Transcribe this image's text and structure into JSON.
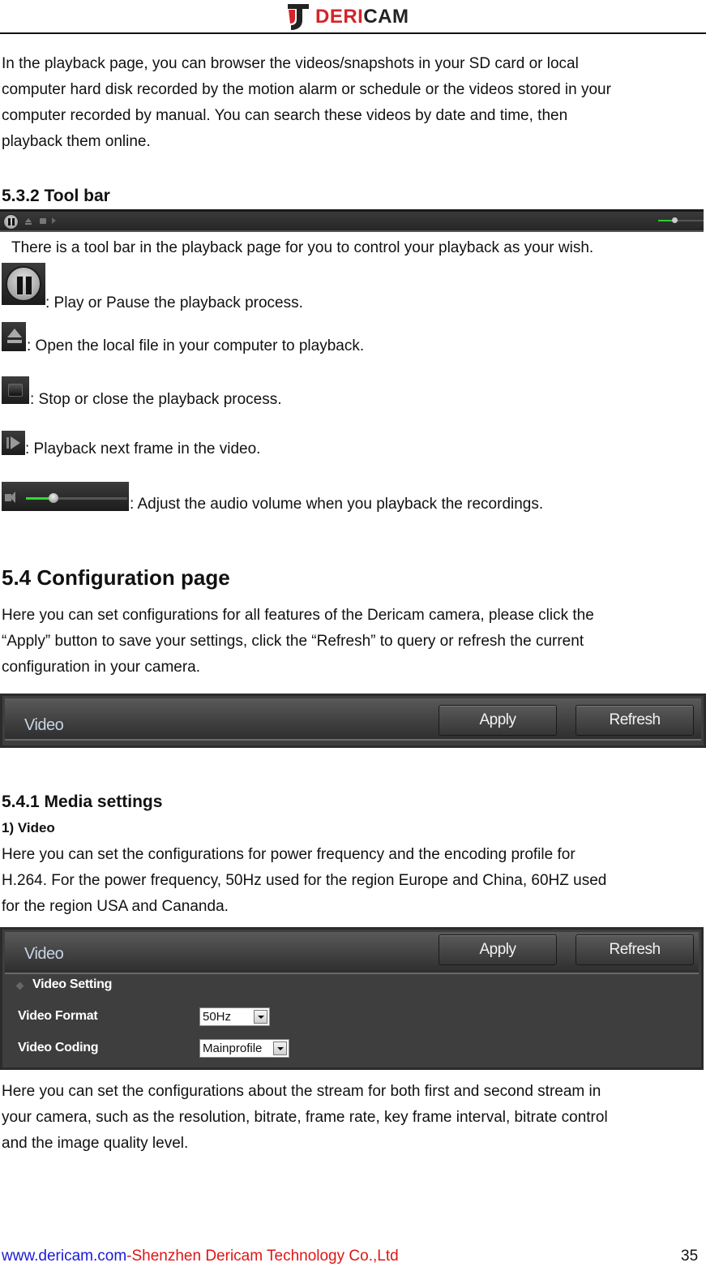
{
  "header": {
    "logo_text_red": "DERI",
    "logo_text_dark": "CAM",
    "brand_color": "#d4242a"
  },
  "intro": {
    "lines": [
      "In the playback page, you can browser the videos/snapshots in your SD card or local",
      "computer hard disk recorded by the motion alarm or schedule or the videos stored in your",
      "computer recorded by manual. You can search these videos by date and time, then",
      "playback them online."
    ]
  },
  "toolbar_section": {
    "heading": "5.3.2 Tool bar",
    "toolbar": {
      "icons": [
        "pause-icon",
        "eject-icon",
        "stop-icon",
        "next-frame-icon",
        "volume-slider"
      ],
      "volume_level_fraction": 0.35
    },
    "description": "There is a tool bar in the playback page for you to control your playback as your wish.",
    "items": [
      {
        "icon": "play-pause-icon",
        "text": ": Play or Pause the playback process."
      },
      {
        "icon": "open-file-icon",
        "text": ": Open the local file in your computer to playback."
      },
      {
        "icon": "stop-icon",
        "text": ": Stop or close the playback process."
      },
      {
        "icon": "next-frame-icon",
        "text": ": Playback next frame in the video."
      },
      {
        "icon": "volume-icon",
        "text": ": Adjust the audio volume when you playback the recordings.",
        "volume_level_fraction": 0.27
      }
    ]
  },
  "config_section": {
    "heading": "5.4 Configuration page",
    "lines": [
      "Here you can set configurations for all features of the Dericam camera, please click the",
      "“Apply” button to save your settings, click the “Refresh” to query or refresh the current",
      "configuration in your camera."
    ],
    "panel": {
      "title": "Video",
      "apply_label": "Apply",
      "refresh_label": "Refresh"
    }
  },
  "media_section": {
    "heading": "5.4.1 Media settings",
    "subheading": "1) Video",
    "lines": [
      "Here you can set the configurations for power frequency and the encoding profile for",
      "H.264. For the power frequency, 50Hz used for the region Europe and China, 60HZ used",
      "for the region USA and Cananda."
    ],
    "panel": {
      "title": "Video",
      "apply_label": "Apply",
      "refresh_label": "Refresh",
      "section_title": "Video Setting",
      "fields": [
        {
          "label": "Video Format",
          "value": "50Hz"
        },
        {
          "label": "Video Coding",
          "value": "Mainprofile"
        }
      ]
    },
    "after_lines": [
      "Here you can set the configurations about the stream for both first and second stream in",
      "your camera, such as the resolution, bitrate, frame rate, key frame interval, bitrate control",
      "and the image quality level."
    ]
  },
  "footer": {
    "url": "www.dericam.com",
    "company": "-Shenzhen Dericam Technology Co.,Ltd",
    "page_number": "35",
    "url_color": "#1a1ad8",
    "company_color": "#e01515"
  }
}
